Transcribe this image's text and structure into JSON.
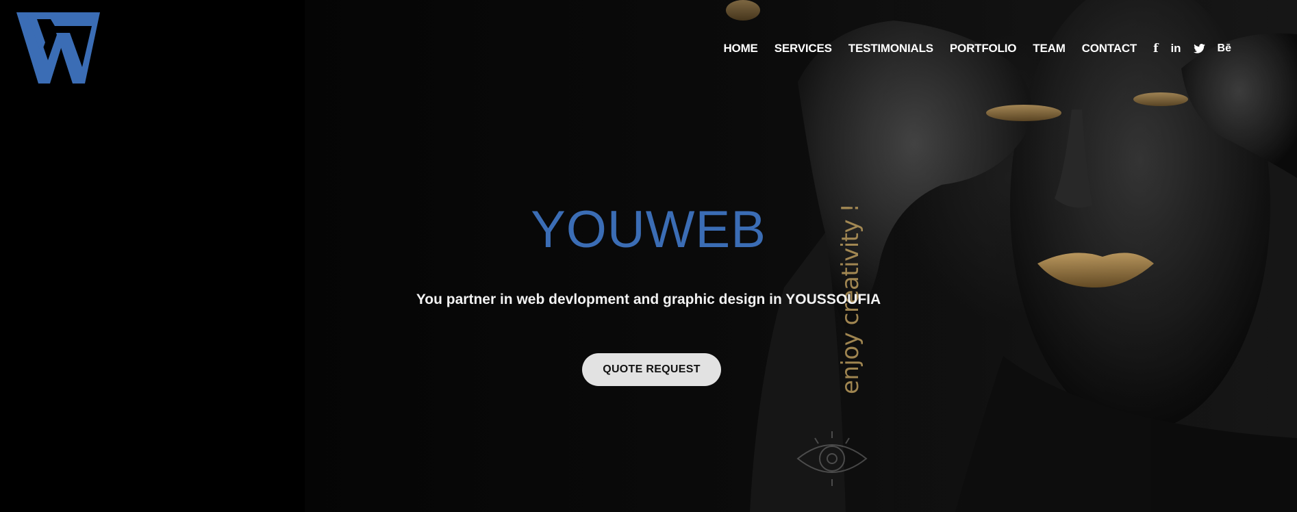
{
  "brand": {
    "logo_name": "W logo",
    "accent_color": "#3b6db5"
  },
  "nav": {
    "items": [
      {
        "label": "HOME"
      },
      {
        "label": "SERVICES"
      },
      {
        "label": "TESTIMONIALS"
      },
      {
        "label": "PORTFOLIO"
      },
      {
        "label": "TEAM"
      },
      {
        "label": "CONTACT"
      }
    ],
    "social": [
      {
        "icon": "facebook-icon",
        "glyph": "f"
      },
      {
        "icon": "linkedin-icon",
        "glyph": "in"
      },
      {
        "icon": "twitter-icon"
      },
      {
        "icon": "behance-icon",
        "glyph": "Bē"
      }
    ]
  },
  "hero": {
    "title": "YOUWEB",
    "tagline": "You partner in web devlopment and graphic design in YOUSSOUFIA",
    "cta_label": "QUOTE REQUEST",
    "photo_tattoo_text": "enjoy creativity !"
  },
  "colors": {
    "background": "#000000",
    "title": "#3b6db5",
    "button_bg": "#e2e2e2",
    "button_text": "#111111",
    "tattoo_gold": "#b99a5c"
  }
}
